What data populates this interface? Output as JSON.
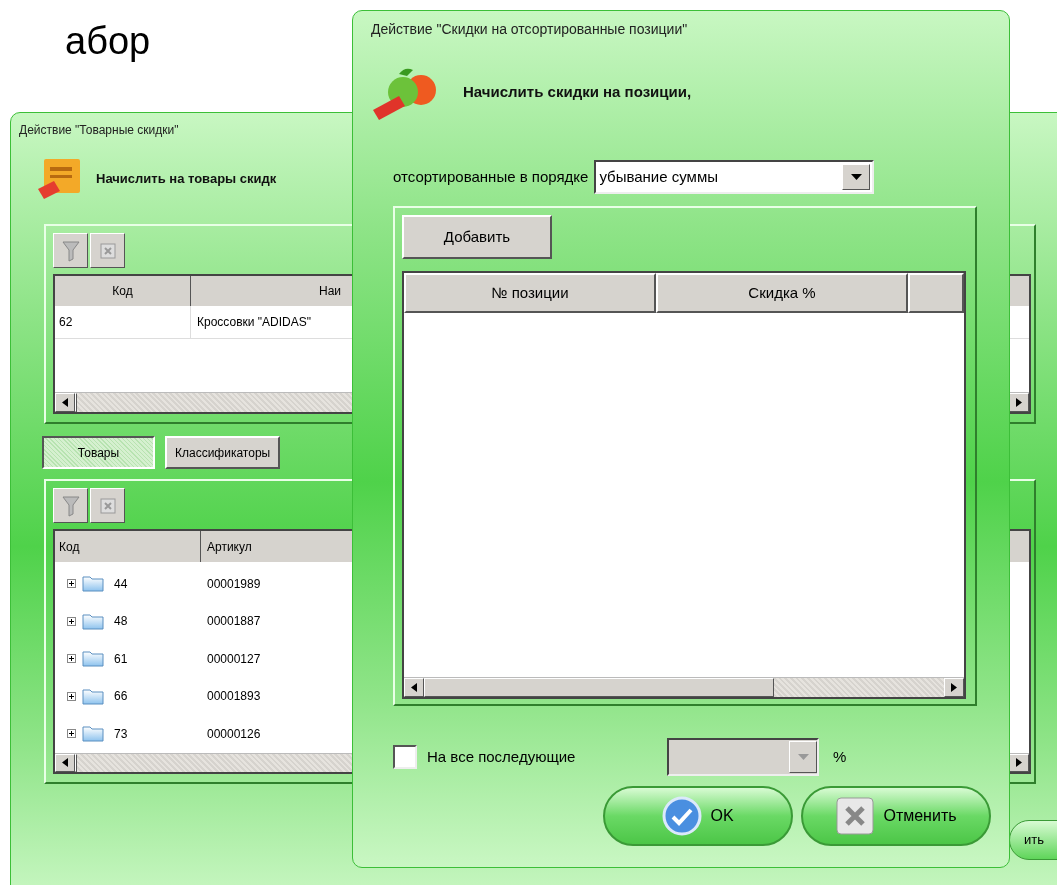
{
  "background_text": "абор",
  "back_window": {
    "title": "Действие \"Товарные скидки\"",
    "heading": "Начислить на товары скидк",
    "top_table": {
      "columns": [
        "Код",
        "Наи"
      ],
      "rows": [
        [
          "62",
          "Кроссовки \"ADIDAS\""
        ]
      ]
    },
    "tabs": [
      {
        "label": "Товары",
        "selected": true
      },
      {
        "label": "Классификаторы",
        "selected": false
      }
    ],
    "tree_table": {
      "columns": [
        "Код",
        "Артикул"
      ],
      "rows": [
        {
          "code": "44",
          "article": "00001989",
          "expanded": false
        },
        {
          "code": "48",
          "article": "00001887",
          "expanded": false
        },
        {
          "code": "61",
          "article": "00000127",
          "expanded": false
        },
        {
          "code": "66",
          "article": "00001893",
          "expanded": false
        },
        {
          "code": "73",
          "article": "00000126",
          "expanded": false
        }
      ]
    },
    "footer_button": "ить"
  },
  "front_window": {
    "title": "Действие \"Скидки на отсортированные позиции\"",
    "heading": "Начислить скидки на позиции,",
    "sort_label": "отсортированные в порядке",
    "sort_value": "убывание суммы",
    "add_button": "Добавить",
    "table": {
      "columns": [
        "№ позиции",
        "Скидка %"
      ]
    },
    "rest": {
      "label": "На все последующие",
      "checked": false,
      "disabled": true,
      "unit": "%"
    },
    "buttons": [
      {
        "kind": "ok",
        "label": "OK"
      },
      {
        "kind": "cancel",
        "label": "Отменить"
      }
    ]
  }
}
